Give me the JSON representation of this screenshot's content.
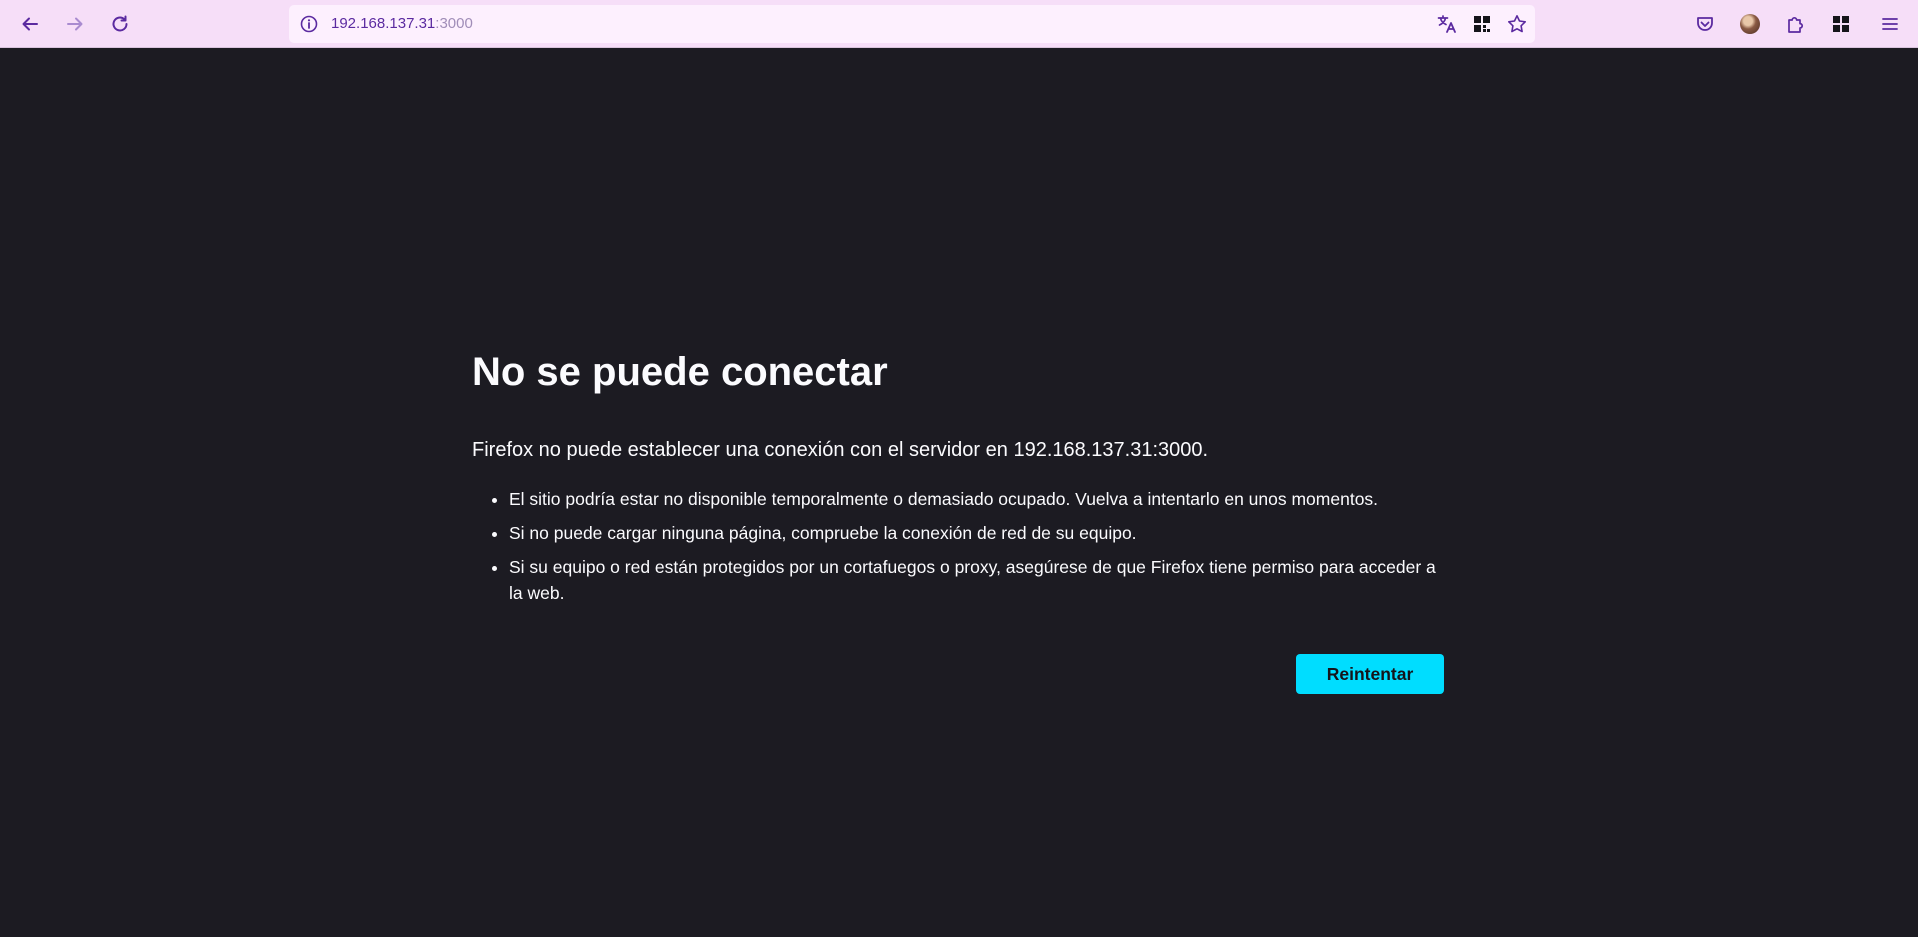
{
  "toolbar": {
    "back_icon": "arrow-left-icon",
    "forward_icon": "arrow-right-icon",
    "reload_icon": "reload-icon",
    "url_host": "192.168.137.31",
    "url_port": ":3000",
    "info_icon": "info-icon",
    "translate_icon": "translate-icon",
    "qr_icon": "qr-code-icon",
    "bookmark_icon": "star-icon",
    "pocket_icon": "pocket-icon",
    "avatar_icon": "account-avatar",
    "extensions_icon": "puzzle-piece-icon",
    "apps_icon": "apps-grid-icon",
    "menu_icon": "hamburger-menu-icon",
    "accent_color": "#5b2aa0"
  },
  "error_page": {
    "title": "No se puede conectar",
    "intro": "Firefox no puede establecer una conexión con el servidor en 192.168.137.31:3000.",
    "reasons": [
      "El sitio podría estar no disponible temporalmente o demasiado ocupado. Vuelva a intentarlo en unos momentos.",
      "Si no puede cargar ninguna página, compruebe la conexión de red de su equipo.",
      "Si su equipo o red están protegidos por un cortafuegos o proxy, asegúrese de que Firefox tiene permiso para acceder a la web."
    ],
    "retry_label": "Reintentar",
    "retry_color": "#00ddff",
    "background_color": "#1c1b22"
  }
}
